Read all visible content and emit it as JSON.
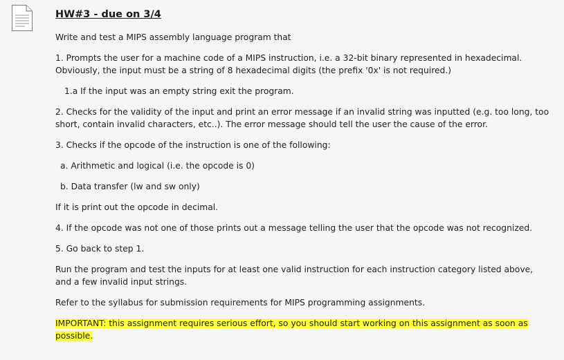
{
  "title": "HW#3 - due on 3/4",
  "paragraphs": {
    "intro": "Write and test a MIPS assembly language program that",
    "step1": "1. Prompts the user for a machine code of a MIPS instruction, i.e. a 32-bit binary represented in hexadecimal. Obviously, the input must be a string of 8 hexadecimal digits (the prefix '0x' is not required.)",
    "step1a": "1.a If the input was an empty string exit the program.",
    "step2": "2. Checks for the validity of the input and print an error message if an invalid string was inputted (e.g. too long, too short, contain invalid characters, etc..). The error message should tell the user the cause of the error.",
    "step3": "3. Checks if the opcode of the instruction is one of the following:",
    "step3a": "a. Arithmetic and logical (i.e. the opcode is 0)",
    "step3b": "b. Data transfer (lw and sw only)",
    "step3c": "If it is print out the opcode in decimal.",
    "step4": "4. If the opcode was not one of those prints out a message telling the user that the opcode was not recognized.",
    "step5": "5. Go back to step 1.",
    "run": "Run the program and test the inputs for at least one valid instruction for each instruction category listed above, and a few invalid input strings.",
    "syllabus": "Refer to the syllabus for submission requirements for MIPS programming assignments.",
    "important": "IMPORTANT: this assignment requires serious effort, so you should start working on this assignment as soon as possible."
  },
  "icons": {
    "document": "document-icon"
  },
  "colors": {
    "highlight": "#ffff3b",
    "background": "#f5f5f5",
    "text": "#222222"
  }
}
